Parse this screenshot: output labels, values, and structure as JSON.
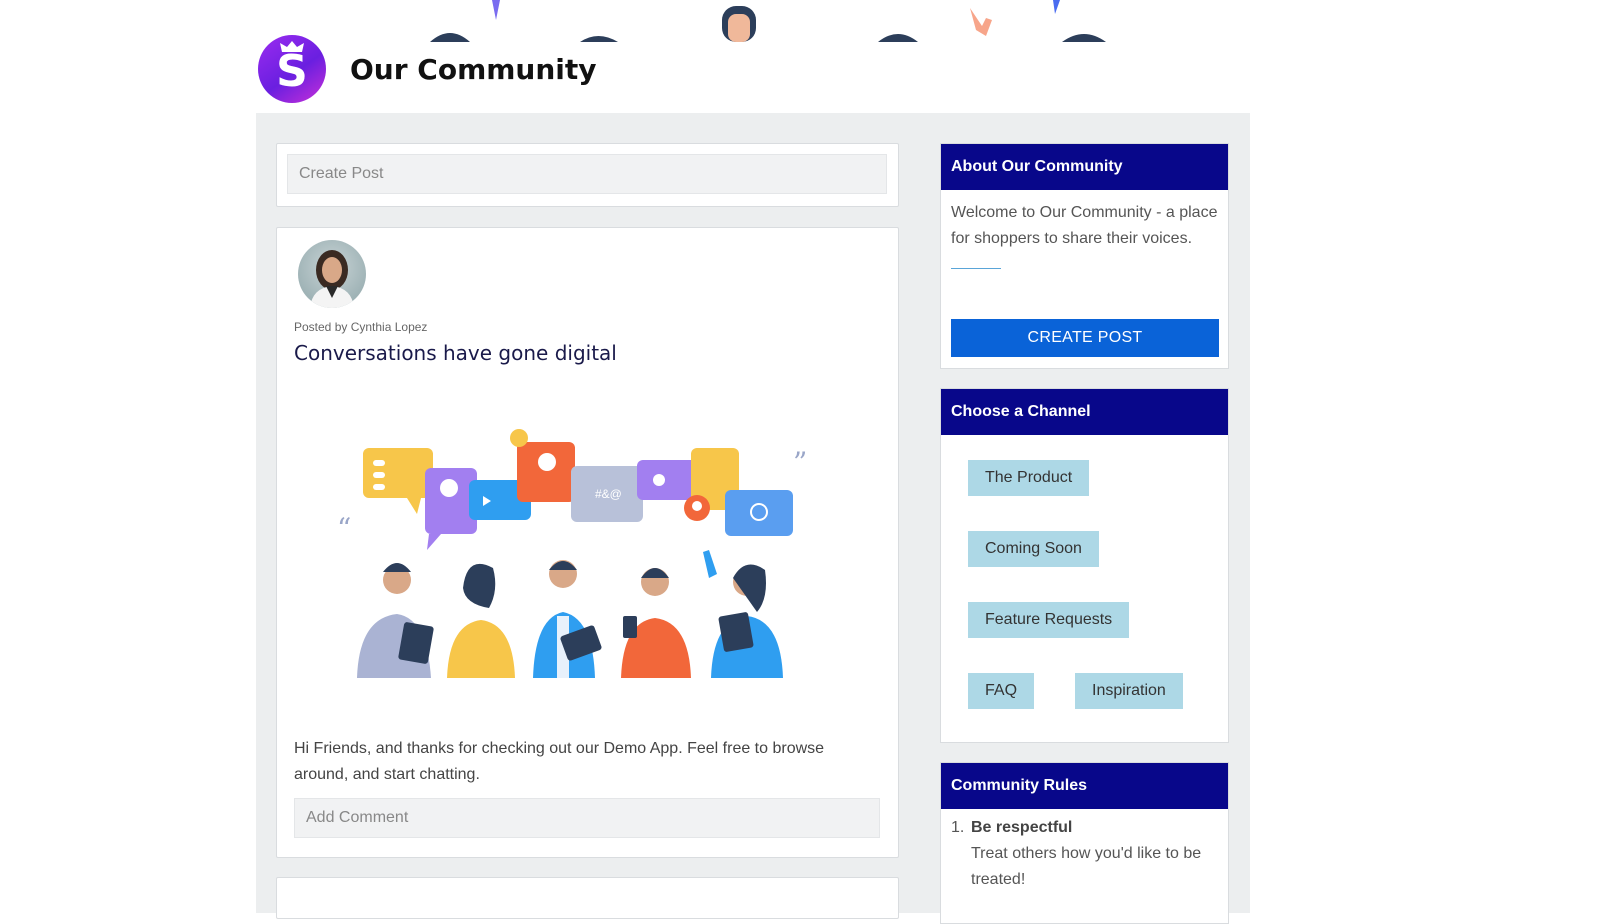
{
  "header": {
    "title": "Our Community",
    "logo_letter": "S"
  },
  "create_post_box": {
    "placeholder": "Create Post"
  },
  "post": {
    "posted_by": "Posted by Cynthia Lopez",
    "title": "Conversations have gone digital",
    "body": "Hi Friends, and thanks for checking out our Demo App. Feel free to browse around, and start chatting.",
    "comment_placeholder": "Add Comment"
  },
  "about": {
    "heading": "About Our Community",
    "text": "Welcome to Our Community - a place for shoppers to share their voices.",
    "button_label": "CREATE POST"
  },
  "channels": {
    "heading": "Choose a Channel",
    "items": [
      "The Product",
      "Coming Soon",
      "Feature Requests",
      "FAQ",
      "Inspiration"
    ]
  },
  "rules": {
    "heading": "Community Rules",
    "items": [
      {
        "number": "1.",
        "title": "Be respectful",
        "description": "Treat others how you'd like to be treated!"
      }
    ]
  },
  "colors": {
    "sidebar_header": "#08078a",
    "primary_button": "#0a63d8",
    "chip_background": "#add8e6",
    "page_background": "#eceeef"
  }
}
